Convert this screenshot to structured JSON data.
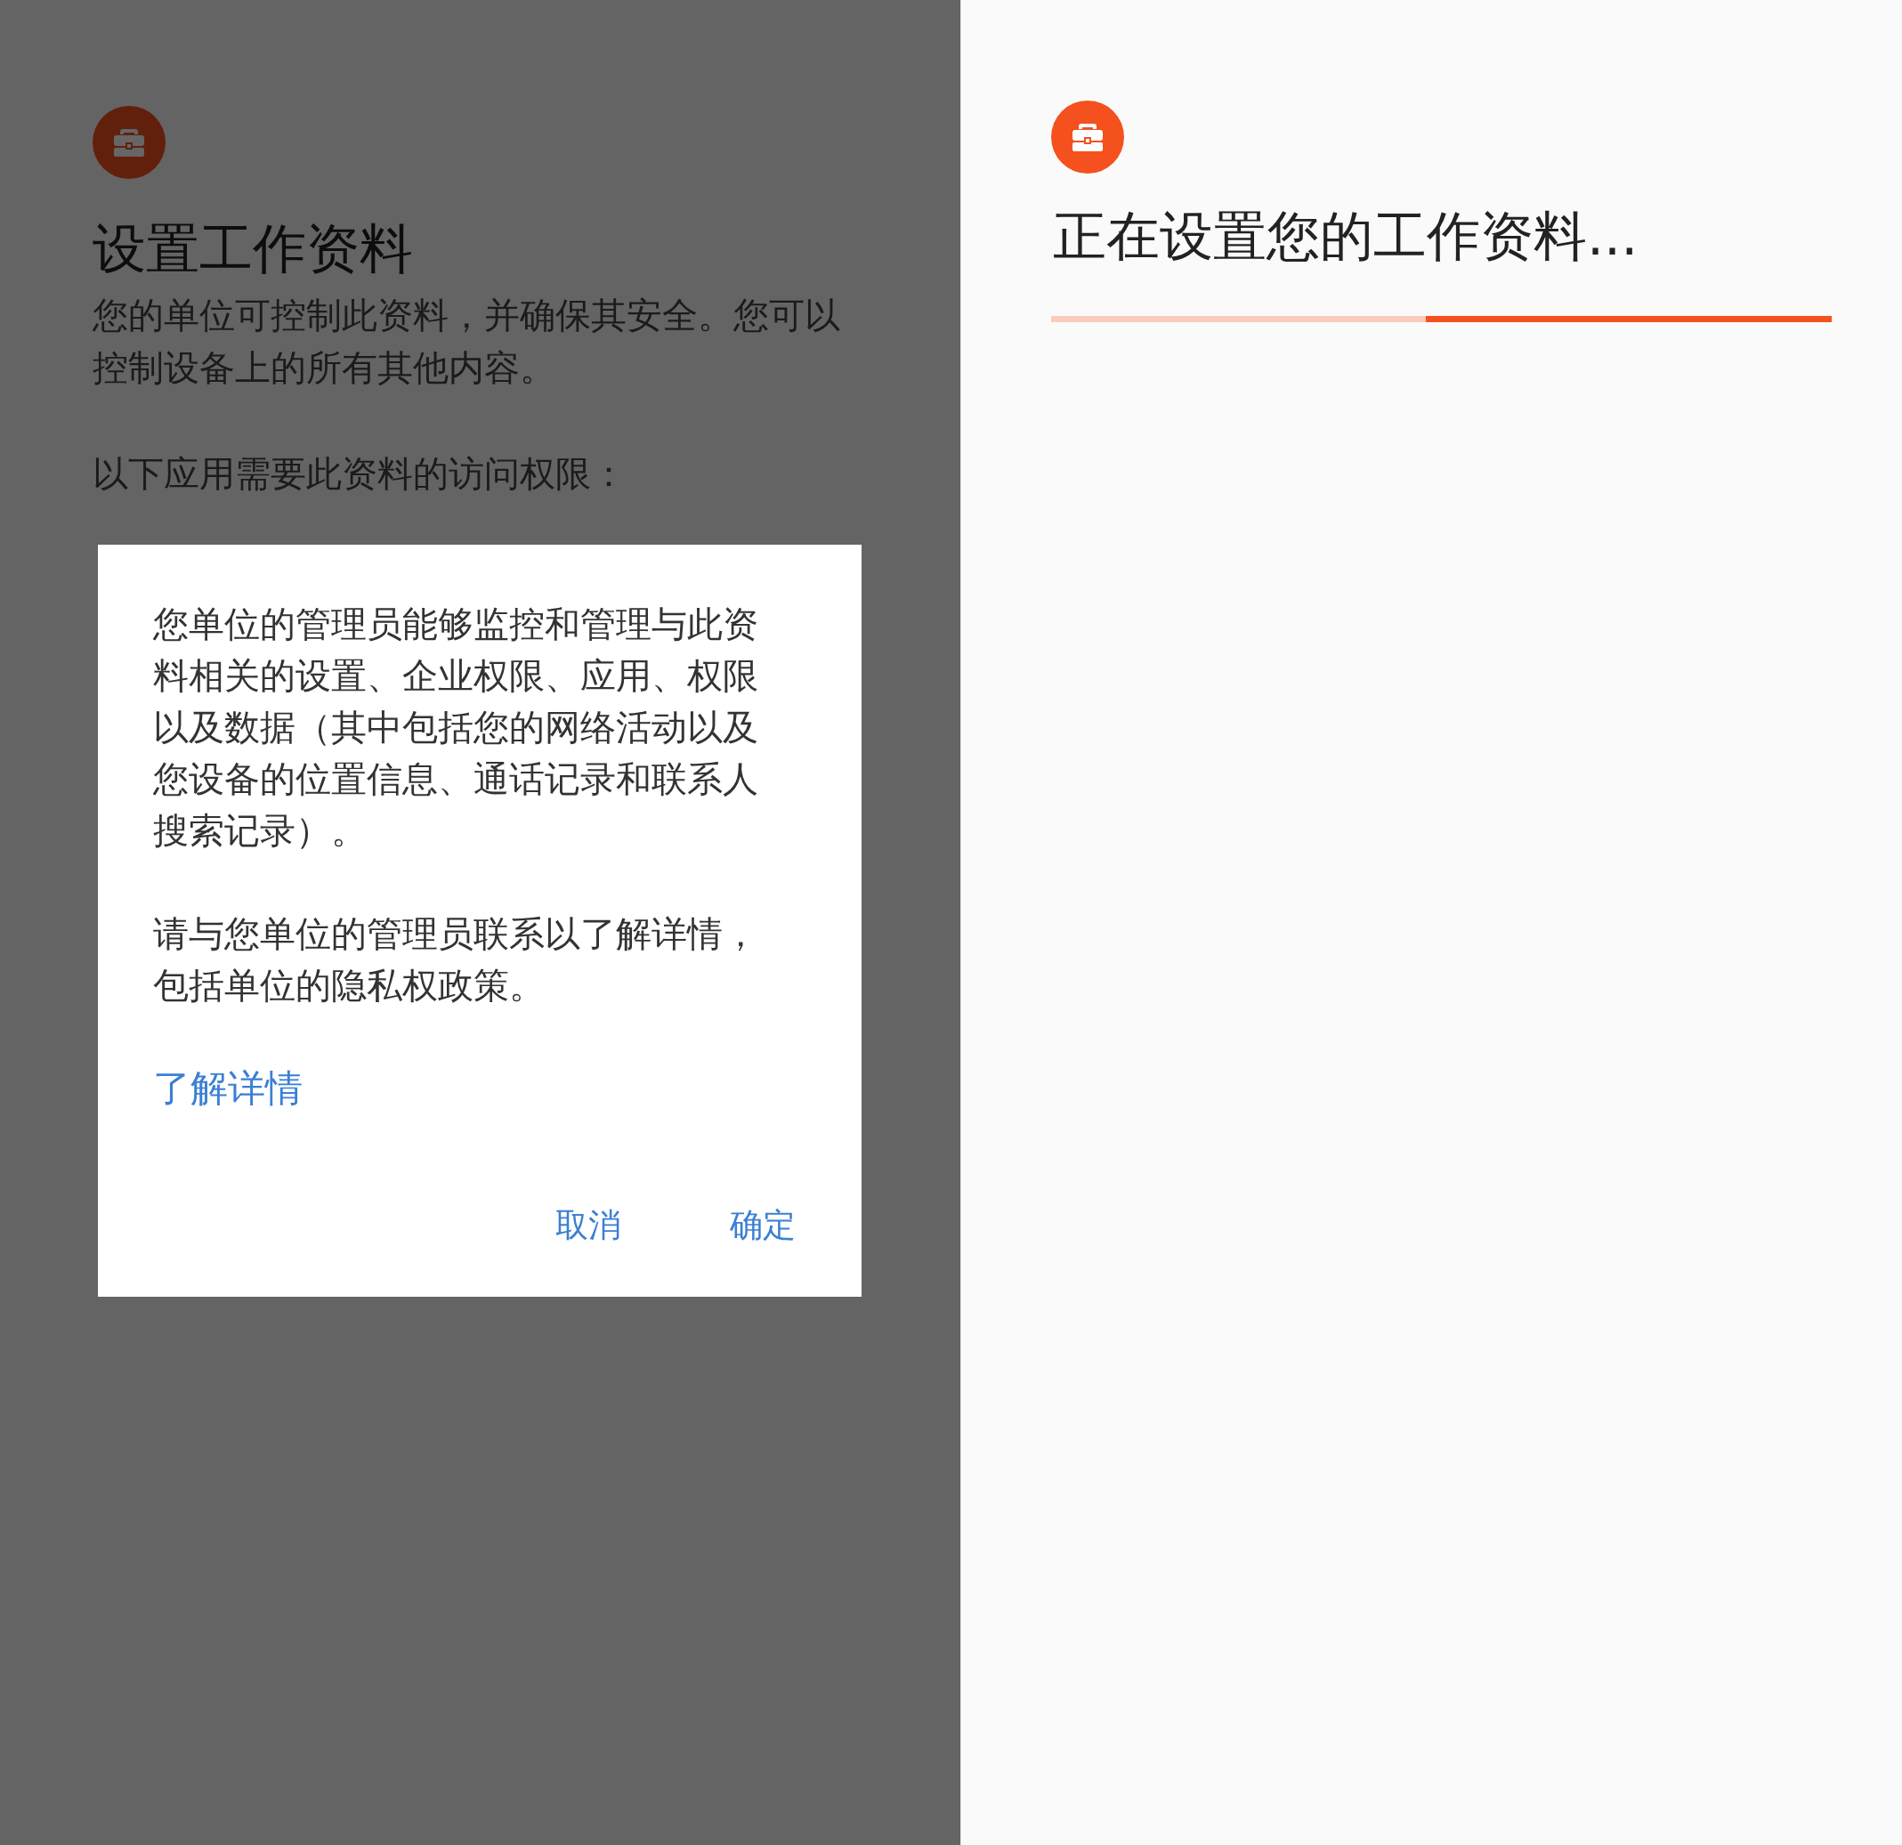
{
  "left_screen": {
    "dimmed": true,
    "title": "设置工作资料",
    "description": "您的单位可控制此资料，并确保其安全。您可以控制设备上的所有其他内容。",
    "apps_heading": "以下应用需要此资料的访问权限：",
    "dialog": {
      "paragraphs": [
        "您单位的管理员能够监控和管理与此资料相关的设置、企业权限、应用、权限以及数据（其中包括您的网络活动以及您设备的位置信息、通话记录和联系人搜索记录）。",
        "请与您单位的管理员联系以了解详情，包括单位的隐私权政策。"
      ],
      "link": "了解详情",
      "buttons": [
        "取消",
        "确定"
      ]
    }
  },
  "right_screen": {
    "title": "正在设置您的工作资料...",
    "progress": {
      "level": 0.52
    }
  }
}
